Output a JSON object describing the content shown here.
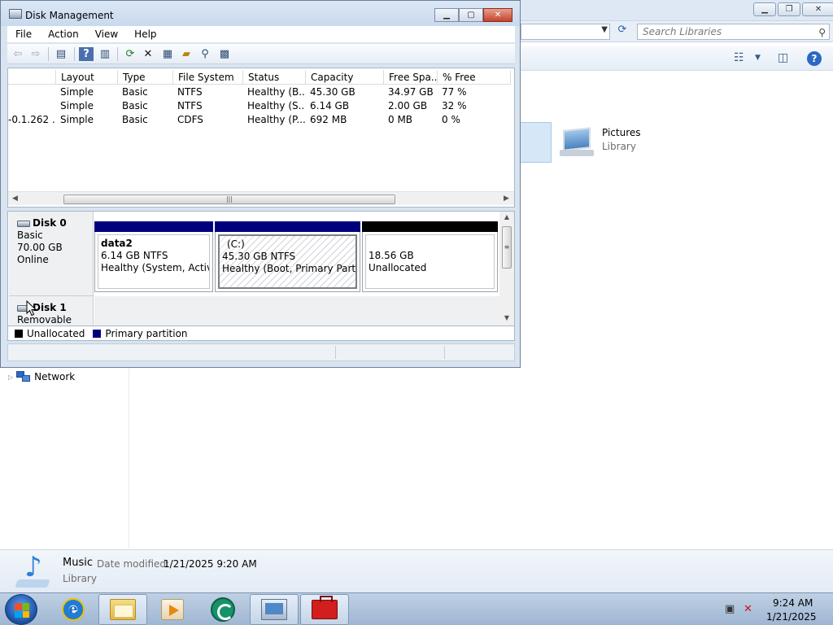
{
  "explorer": {
    "search_placeholder": "Search Libraries",
    "pictures": {
      "title": "Pictures",
      "subtitle": "Library"
    },
    "network_label": "Network",
    "details": {
      "title": "Music",
      "date_label": "Date modified:",
      "date_value": "1/21/2025 9:20 AM",
      "subtitle": "Library"
    }
  },
  "disk_mgmt": {
    "title": "Disk Management",
    "menu": [
      "File",
      "Action",
      "View",
      "Help"
    ],
    "columns": [
      "Layout",
      "Type",
      "File System",
      "Status",
      "Capacity",
      "Free Spa...",
      "% Free"
    ],
    "volumes": [
      {
        "volume": "",
        "layout": "Simple",
        "type": "Basic",
        "fs": "NTFS",
        "status": "Healthy (B...",
        "capacity": "45.30 GB",
        "free": "34.97 GB",
        "pct": "77 %"
      },
      {
        "volume": "",
        "layout": "Simple",
        "type": "Basic",
        "fs": "NTFS",
        "status": "Healthy (S...",
        "capacity": "6.14 GB",
        "free": "2.00 GB",
        "pct": "32 %"
      },
      {
        "volume": "-0.1.262 ...",
        "layout": "Simple",
        "type": "Basic",
        "fs": "CDFS",
        "status": "Healthy (P...",
        "capacity": "692 MB",
        "free": "0 MB",
        "pct": "0 %"
      }
    ],
    "disk0": {
      "name": "Disk 0",
      "type": "Basic",
      "size": "70.00 GB",
      "state": "Online",
      "partitions": [
        {
          "name": "data2",
          "size": "6.14 GB NTFS",
          "status": "Healthy (System, Active,"
        },
        {
          "name": "(C:)",
          "size": "45.30 GB NTFS",
          "status": "Healthy (Boot, Primary Partition"
        },
        {
          "name": "",
          "size": "18.56 GB",
          "status": "Unallocated"
        }
      ]
    },
    "disk1": {
      "name": "Disk 1",
      "type": "Removable (D:)"
    },
    "legend": [
      "Unallocated",
      "Primary partition"
    ],
    "colors": {
      "primary": "#00007f",
      "unallocated": "#000000"
    }
  },
  "taskbar": {
    "time": "9:24 AM",
    "date": "1/21/2025"
  }
}
